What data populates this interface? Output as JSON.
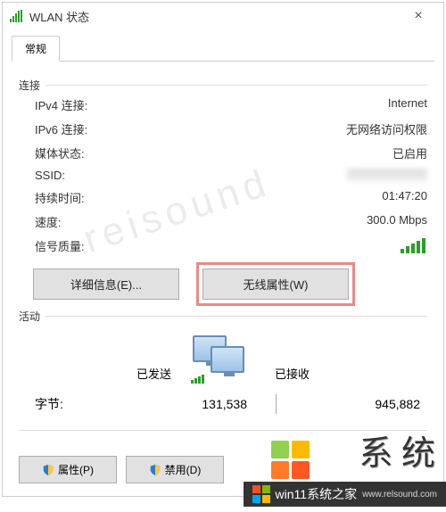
{
  "window": {
    "title": "WLAN 状态",
    "tab_general": "常规"
  },
  "connection": {
    "group": "连接",
    "ipv4_label": "IPv4 连接:",
    "ipv4_value": "Internet",
    "ipv6_label": "IPv6 连接:",
    "ipv6_value": "无网络访问权限",
    "media_label": "媒体状态:",
    "media_value": "已启用",
    "ssid_label": "SSID:",
    "duration_label": "持续时间:",
    "duration_value": "01:47:20",
    "speed_label": "速度:",
    "speed_value": "300.0 Mbps",
    "signal_label": "信号质量:"
  },
  "buttons": {
    "details": "详细信息(E)...",
    "wireless_props": "无线属性(W)"
  },
  "activity": {
    "group": "活动",
    "sent": "已发送",
    "received": "已接收",
    "bytes_label": "字节:",
    "bytes_sent": "131,538",
    "bytes_received": "945,882"
  },
  "footer": {
    "properties": "属性(P)",
    "disable": "禁用(D)"
  },
  "watermarks": {
    "faint": "reisound",
    "strip": "win11系统之家",
    "strip_url": "www.relsound.com",
    "ghost": "系 统"
  }
}
